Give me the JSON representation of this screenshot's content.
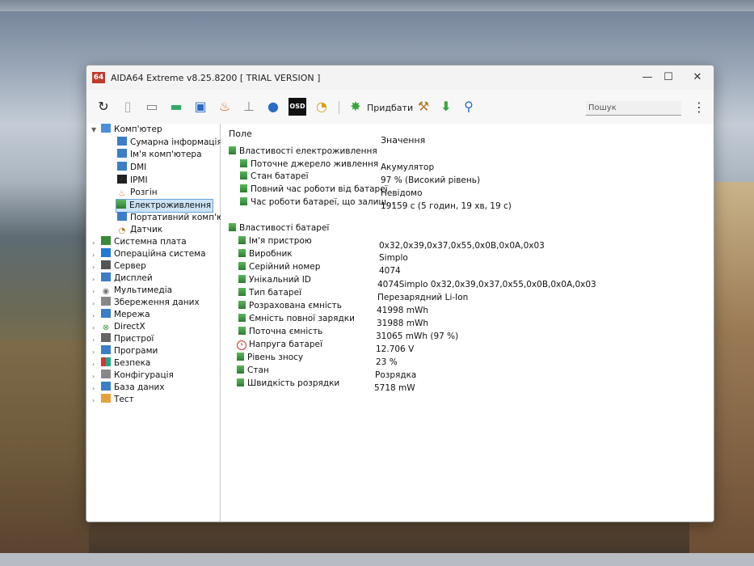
{
  "window": {
    "app_logo": "64",
    "title": "AIDA64 Extreme v8.25.8200  [ TRIAL VERSION ]",
    "minimize": "—",
    "maximize": "☐",
    "close": "✕"
  },
  "toolbar": {
    "add_label": "Придбати",
    "search_placeholder": "Пошук",
    "more": "⋮",
    "icons": [
      "refresh-icon",
      "report-icon",
      "memory-icon",
      "ram-icon",
      "network-icon",
      "flame-icon",
      "antenna-icon",
      "user-icon",
      "osd-icon",
      "gauge-icon",
      "star-icon",
      "tools-icon",
      "download-icon",
      "search-icon"
    ]
  },
  "tree": {
    "root": "Комп'ютер",
    "items": [
      "Сумарна інформація",
      "Ім'я комп'ютера",
      "DMI",
      "IPMI",
      "Розгін",
      "Електроживлення",
      "Портативний комп'юте",
      "Датчик"
    ],
    "groups": [
      "Системна плата",
      "Операційна система",
      "Сервер",
      "Дисплей",
      "Мультимедіа",
      "Збереження даних",
      "Мережа",
      "DirectX",
      "Пристрої",
      "Програми",
      "Безпека",
      "Конфігурація",
      "База даних",
      "Тест"
    ]
  },
  "panel": {
    "col_field": "Поле",
    "col_value": "Значення",
    "section1": "Властивості електроживлення",
    "power": [
      {
        "label": "Поточне джерело живлення",
        "value": "Акумулятор"
      },
      {
        "label": "Стан батареї",
        "value": "97 % (Високий рівень)"
      },
      {
        "label": "Повний час роботи від батареї",
        "value": "Невідомо"
      },
      {
        "label": "Час роботи батареї, що залиш...",
        "value": "19159 с (5 годин, 19 хв, 19 с)"
      }
    ],
    "section2": "Властивості батареї",
    "battery": [
      {
        "label": "Ім'я пристрою",
        "value": "0x32,0x39,0x37,0x55,0x0B,0x0A,0x03"
      },
      {
        "label": "Виробник",
        "value": "Simplo"
      },
      {
        "label": "Серійний номер",
        "value": "4074"
      },
      {
        "label": "Унікальний ID",
        "value": "4074Simplo 0x32,0x39,0x37,0x55,0x0B,0x0A,0x03"
      },
      {
        "label": "Тип батареї",
        "value": "Перезарядний Li-Ion"
      },
      {
        "label": "Розрахована ємність",
        "value": "41998 mWh"
      },
      {
        "label": "Ємність повної зарядки",
        "value": "31988 mWh"
      },
      {
        "label": "Поточна ємність",
        "value": "31065 mWh  (97 %)"
      },
      {
        "label": "Напруга батареї",
        "value": "12.706 V"
      },
      {
        "label": "Рівень зносу",
        "value": "23 %"
      },
      {
        "label": "Стан",
        "value": "Розрядка"
      },
      {
        "label": "Швидкість розрядки",
        "value": "5718 mW"
      }
    ]
  }
}
